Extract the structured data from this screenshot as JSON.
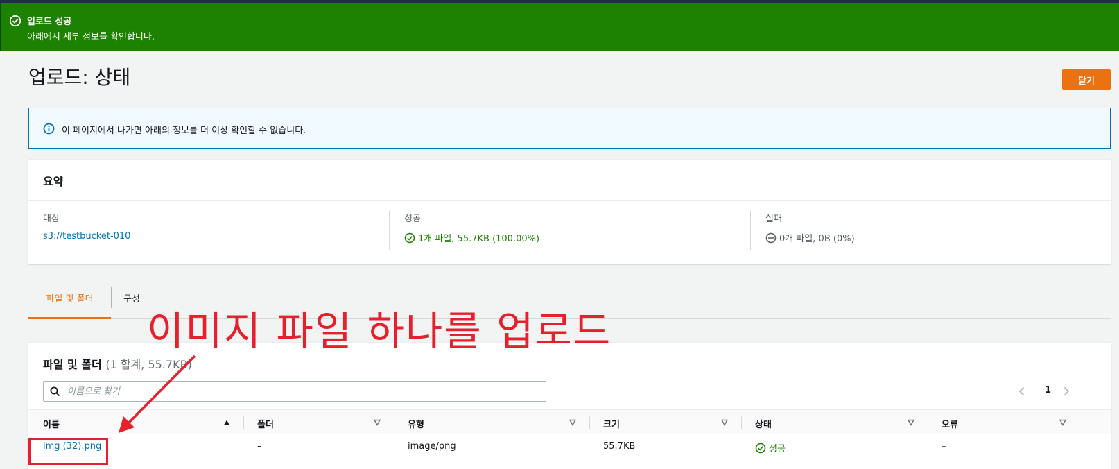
{
  "flash": {
    "title": "업로드 성공",
    "description": "아래에서 세부 정보를 확인합니다."
  },
  "page": {
    "title": "업로드: 상태",
    "close_label": "닫기"
  },
  "info": {
    "text": "이 페이지에서 나가면 아래의 정보를 더 이상 확인할 수 없습니다."
  },
  "summary": {
    "heading": "요약",
    "destination_label": "대상",
    "destination_value": "s3://testbucket-010",
    "success_label": "성공",
    "success_value": "1개 파일, 55.7KB (100.00%)",
    "failed_label": "실패",
    "failed_value": "0개 파일, 0B (0%)"
  },
  "tabs": [
    {
      "label": "파일 및 폴더",
      "active": true
    },
    {
      "label": "구성",
      "active": false
    }
  ],
  "annotation": {
    "text": "이미지 파일 하나를 업로드"
  },
  "files": {
    "heading": "파일 및 폴더",
    "count": "(1 합계, 55.7KB)",
    "search_placeholder": "이름으로 찾기",
    "page_number": "1",
    "columns": [
      "이름",
      "폴더",
      "유형",
      "크기",
      "상태",
      "오류"
    ],
    "rows": [
      {
        "name": "img (32).png",
        "folder": "–",
        "type": "image/png",
        "size": "55.7KB",
        "status": "성공",
        "error": "–"
      }
    ]
  },
  "colors": {
    "success": "#1d8102",
    "accent": "#ec7211",
    "link": "#0073bb",
    "annotation": "#e4212c"
  }
}
